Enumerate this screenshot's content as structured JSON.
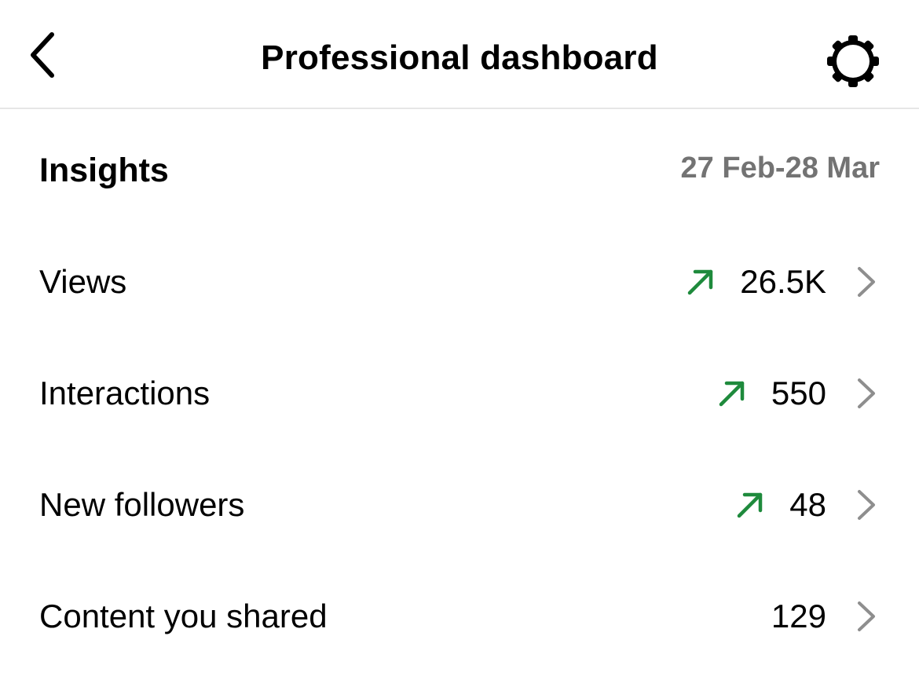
{
  "header": {
    "title": "Professional dashboard",
    "back_icon": "chevron-left-icon",
    "settings_icon": "gear-icon"
  },
  "insights": {
    "title": "Insights",
    "date_range": "27 Feb-28 Mar"
  },
  "metrics": [
    {
      "label": "Views",
      "value": "26.5K",
      "trend": "up"
    },
    {
      "label": "Interactions",
      "value": "550",
      "trend": "up"
    },
    {
      "label": "New followers",
      "value": "48",
      "trend": "up"
    },
    {
      "label": "Content you shared",
      "value": "129",
      "trend": "none"
    }
  ],
  "colors": {
    "trend_up": "#1e8a3c",
    "muted_text": "#737373",
    "chevron": "#8e8e8e",
    "divider": "#e6e6e6"
  }
}
